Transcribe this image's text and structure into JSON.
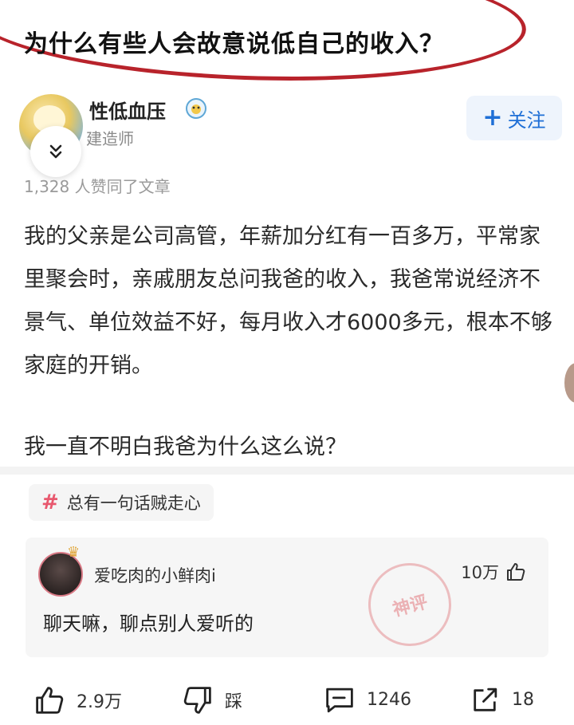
{
  "question": {
    "title": "为什么有些人会故意说低自己的收入？"
  },
  "author": {
    "name": "性低血压",
    "title": "建造师",
    "follow_label": "关注"
  },
  "likes_line": "1,328 人赞同了文章",
  "article": {
    "paragraphs": [
      "我的父亲是公司高管，年薪加分红有一百多万，平常家里聚会时，亲戚朋友总问我爸的收入，我爸常说经济不景气、单位效益不好，每月收入才6000多元，根本不够家庭的开销。",
      "我一直不明白我爸为什么这么说？"
    ]
  },
  "topic": {
    "label": "总有一句话贼走心"
  },
  "hot_comment": {
    "user": "爱吃肉的小鲜肉i",
    "likes": "10万",
    "text": "聊天嘛，聊点别人爱听的"
  },
  "actions": {
    "upvote": "2.9万",
    "downvote": "踩",
    "comments": "1246",
    "share": "18"
  },
  "colors": {
    "circle": "#b8232b",
    "follow_text": "#1f6fd6",
    "follow_bg": "#eef4fc",
    "topic_hash": "#e8586e"
  }
}
